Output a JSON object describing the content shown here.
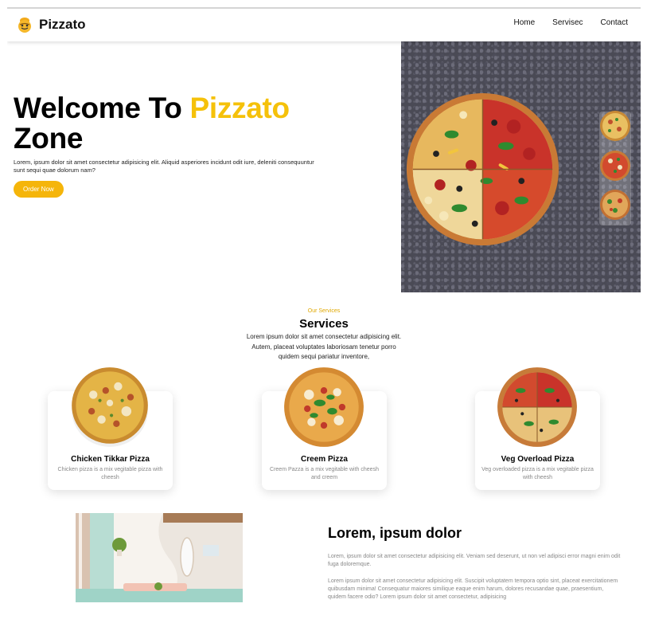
{
  "brand": {
    "name": "Pizzato"
  },
  "nav": {
    "items": [
      "Home",
      "Servisec",
      "Contact"
    ]
  },
  "hero": {
    "title_start": "Welcome To",
    "title_accent": "Pizzato",
    "title_end": "Zone",
    "description": "Lorem, ipsum dolor sit amet consectetur adipisicing elit. Aliquid asperiores incidunt odit iure, deleniti consequuntur sunt sequi quae dolorum nam?",
    "cta": "Order Now"
  },
  "services": {
    "subtitle": "Our Services",
    "title": "Services",
    "description": "Lorem ipsum dolor sit amet consectetur adipisicing elit. Autem, placeat voluptates laboriosam tenetur porro quidem sequi pariatur inventore,",
    "cards": [
      {
        "title": "Chicken Tikkar Pizza",
        "description": "Chicken pizza is a mix vegitable pizza with cheesh"
      },
      {
        "title": "Creem Pizza",
        "description": "Creem Pazza is a mix vegitable with cheesh and creem"
      },
      {
        "title": "Veg Overload Pizza",
        "description": "Veg overloaded pizza is a mix vegitable pizza with cheesh"
      }
    ]
  },
  "about": {
    "title": "Lorem, ipsum dolor",
    "p1": "Lorem, ipsum dolor sit amet consectetur adipisicing elit. Veniam sed deserunt, ut non vel adipisci error magni enim odit fuga doloremque.",
    "p2": "Lorem ipsum dolor sit amet consectetur adipisicing elit. Suscipit voluptatem tempora optio sint, placeat exercitationem quibusdam minima! Consequatur maiores similique eaque enim harum, dolores recusandae quae, praesentium, quidem facere odio? Lorem ipsum dolor sit amet consectetur, adipisicing"
  },
  "colors": {
    "accent": "#f5c10a",
    "button": "#f5b50a",
    "hero_bg": "#4a4a55"
  },
  "icons": {
    "logo": "pizza-chef-icon"
  }
}
